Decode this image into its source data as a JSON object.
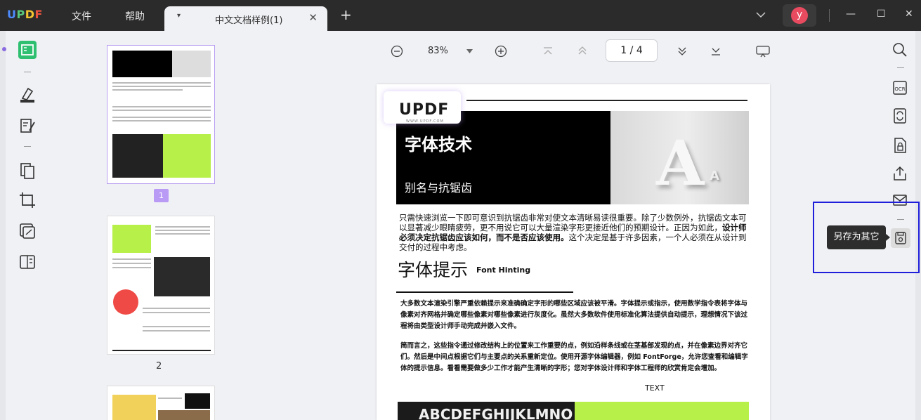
{
  "app": {
    "logo": {
      "u": "U",
      "p": "P",
      "d": "D",
      "f": "F"
    },
    "menu": {
      "file": "文件",
      "help": "帮助"
    },
    "tab": {
      "title": "中文文档样例(1)",
      "caret": "▾",
      "close": "✕"
    },
    "new_tab": "+",
    "avatar_letter": "y",
    "window": {
      "minimize": "—",
      "maximize": "☐",
      "close": "✕"
    }
  },
  "thumbnails": {
    "page1_badge": "1",
    "page2_label": "2"
  },
  "zoom": {
    "value": "83%",
    "current_page": "1",
    "separator": "/",
    "total_pages": "4"
  },
  "document": {
    "logo": "UPDF",
    "logo_sub": "WWW.UPDF.COM",
    "hero_title": "字体技术",
    "hero_subtitle": "别名与抗锯齿",
    "hero_A": "A",
    "para1_a": "只需快速浏览一下即可意识到抗锯齿非常对使文本清晰易读很重要。除了少数例外，抗锯齿文本可以显著减少眼睛疲劳，更不用说它可以大量渲染字形更接近他们的预期设计。正因为如此，",
    "para1_bold": "设计师必须决定抗锯齿应该如何，而不是否应该使用。",
    "para1_b": "这个决定是基于许多因素，一个人必须在从设计到交付的过程中考虑。",
    "h2": "字体提示",
    "h2_small": "Font Hinting",
    "para2": "大多数文本渲染引擎严重依赖提示来准确确定字形的哪些区域应该被平滑。字体提示或指示，使用数学指令表将字体与像素对齐网格并确定哪些像素对哪些像素进行灰度化。虽然大多数软件使用标准化算法提供自动提示，理想情况下该过程将由类型设计师手动完成并嵌入文件。",
    "para3": "简而言之，这些指令通过修改结构上的位置来工作重要的点，例如沿样条线或在茎基部发现的点，并在像素边界对齐它们。然后是中间点根据它们与主要点的关系重新定位。使用开源字体编辑器，例如 FontForge，允许您查看和编辑字体的提示信息。看看需要做多少工作才能产生清晰的字形；您对字体设计师和字体工程师的欣赏肯定会增加。",
    "text_tag": "TEXT",
    "bottom_img_text": "ABCDEFGHIJKLMNO"
  },
  "tooltip": {
    "save_as": "另存为其它"
  },
  "colors": {
    "accent": "#b99af5",
    "highlight_box": "#1f1fdb",
    "titlebar": "#2b2b2b",
    "green": "#b8f04a"
  }
}
